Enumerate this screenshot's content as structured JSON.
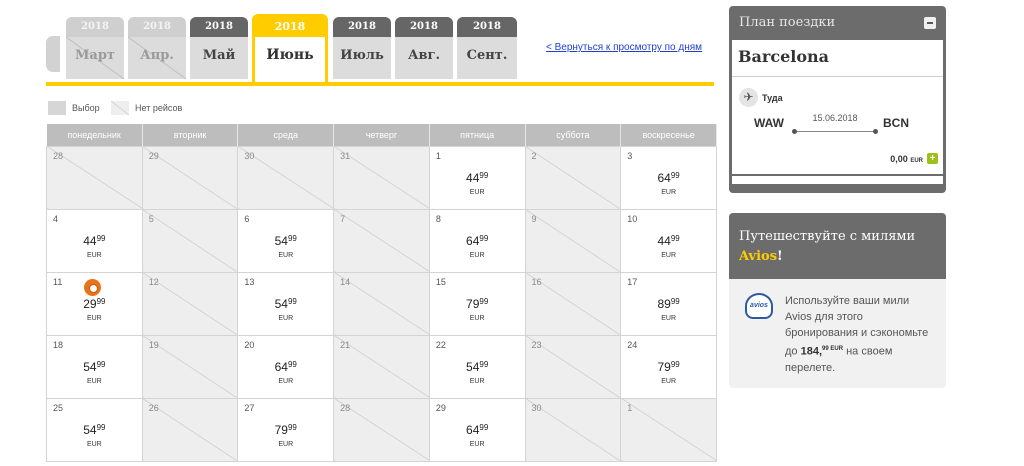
{
  "tabs": [
    {
      "year": "2018",
      "month": "Март",
      "state": "disabled"
    },
    {
      "year": "2018",
      "month": "Апр.",
      "state": "disabled"
    },
    {
      "year": "2018",
      "month": "Май",
      "state": "dark"
    },
    {
      "year": "2018",
      "month": "Июнь",
      "state": "active"
    },
    {
      "year": "2018",
      "month": "Июль",
      "state": "dark"
    },
    {
      "year": "2018",
      "month": "Авг.",
      "state": "dark"
    },
    {
      "year": "2018",
      "month": "Сент.",
      "state": "dark"
    }
  ],
  "back_link": "< Вернуться к просмотру по дням",
  "legend": {
    "selected": "Выбор",
    "no_flights": "Нет рейсов"
  },
  "weekdays": [
    "понедельник",
    "вторник",
    "среда",
    "четверг",
    "пятница",
    "суббота",
    "воскресенье"
  ],
  "calendar": {
    "currency": "EUR",
    "weeks": [
      [
        {
          "day": "28"
        },
        {
          "day": "29"
        },
        {
          "day": "30"
        },
        {
          "day": "31"
        },
        {
          "day": "1",
          "price": "44",
          "cents": "99"
        },
        {
          "day": "2"
        },
        {
          "day": "3",
          "price": "64",
          "cents": "99"
        }
      ],
      [
        {
          "day": "4",
          "price": "44",
          "cents": "99"
        },
        {
          "day": "5"
        },
        {
          "day": "6",
          "price": "54",
          "cents": "99"
        },
        {
          "day": "7"
        },
        {
          "day": "8",
          "price": "64",
          "cents": "99"
        },
        {
          "day": "9"
        },
        {
          "day": "10",
          "price": "44",
          "cents": "99"
        }
      ],
      [
        {
          "day": "11",
          "price": "29",
          "cents": "99",
          "promo": true
        },
        {
          "day": "12"
        },
        {
          "day": "13",
          "price": "54",
          "cents": "99"
        },
        {
          "day": "14"
        },
        {
          "day": "15",
          "price": "79",
          "cents": "99"
        },
        {
          "day": "16"
        },
        {
          "day": "17",
          "price": "89",
          "cents": "99"
        }
      ],
      [
        {
          "day": "18",
          "price": "54",
          "cents": "99"
        },
        {
          "day": "19"
        },
        {
          "day": "20",
          "price": "64",
          "cents": "99"
        },
        {
          "day": "21"
        },
        {
          "day": "22",
          "price": "54",
          "cents": "99"
        },
        {
          "day": "23"
        },
        {
          "day": "24",
          "price": "79",
          "cents": "99"
        }
      ],
      [
        {
          "day": "25",
          "price": "54",
          "cents": "99"
        },
        {
          "day": "26"
        },
        {
          "day": "27",
          "price": "79",
          "cents": "99"
        },
        {
          "day": "28"
        },
        {
          "day": "29",
          "price": "64",
          "cents": "99"
        },
        {
          "day": "30"
        },
        {
          "day": "1"
        }
      ]
    ]
  },
  "trip_plan": {
    "title": "План поездки",
    "city": "Barcelona",
    "direction": "Туда",
    "from": "WAW",
    "to": "BCN",
    "date": "15.06.2018",
    "total": "0,00",
    "total_currency": "EUR"
  },
  "avios": {
    "title_line1": "Путешествуйте с милями",
    "brand": "Avios",
    "exclaim": "!",
    "logo_text": "avios",
    "text_before": "Используйте ваши мили Avios для этого бронирования и сэкономьте до",
    "amount": "184,",
    "amount_cents": "99 EUR",
    "text_after": "на своем перелете."
  },
  "colors": {
    "accent": "#ffcc00",
    "panel": "#6c6c6c",
    "link": "#1f3fd3",
    "promo": "#e8731a",
    "add": "#9cbf1b"
  }
}
